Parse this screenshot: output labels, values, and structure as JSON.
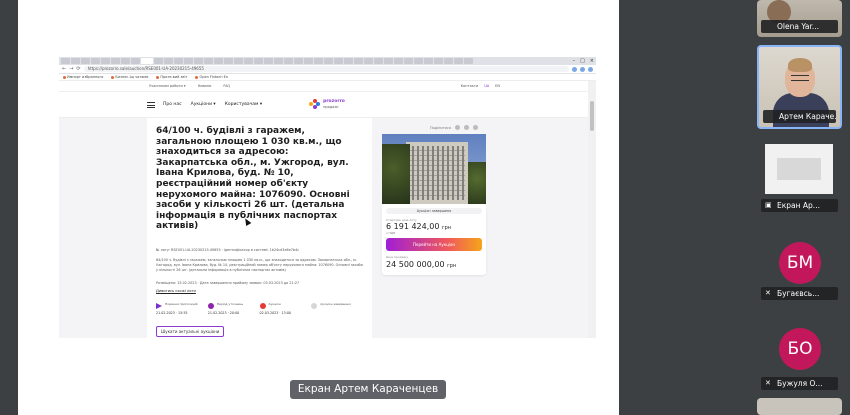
{
  "browser": {
    "url": "https://prozorro.sale/auction/RSE001-UA-20230215-49655",
    "window_controls": [
      "–",
      "□",
      "×"
    ],
    "nav": [
      "←",
      "→",
      "⟳"
    ],
    "bookmarks": [
      "Импорт избранного",
      "Бизнес-Іщ чатами",
      "Проте-вий звіт",
      "Open Fintech Ex"
    ]
  },
  "site": {
    "topbar_items": [
      "Учасникам роботи ▾",
      "Новини",
      "FAQ"
    ],
    "topbar_right": [
      "Контакти",
      "UA",
      "EN"
    ],
    "nav_items": [
      "Про нас",
      "Аукціони ▾",
      "Користувачам ▾"
    ],
    "logo_top": "prozorro",
    "logo_bottom": "продажі",
    "lot": {
      "title": "64/100 ч. будівлі з гаражем, загальною площею 1 030 кв.м., що знаходиться за адресою: Закарпатська обл., м. Ужгород, вул. Івана Крилова, буд. № 10, реєстраційний номер об'єкту нерухомого майна: 1076090. Основні засоби у кількості 26 шт. (детальна інформація в публічних паспортах активів)",
      "meta": "№ лоту: RSE001-UA-20230215-49655 · ідентифікатор в системі: 1b24cd3e6e7b4c",
      "description": "64/100 ч. будівлі з гаражем, загальною площею 1 030 кв.м., що знаходиться за адресою: Закарпатська обл., м. Ужгород, вул. Івана Крилова, буд. № 10, реєстраційний номер об'єкту нерухомого майна: 1076090. Основні засоби у кількості 26 шт. (детальна інформація в публічних паспортах активів)",
      "dates": "Розміщено: 15.02.2023 · Дата завершення прийому заявок: 03.03.2023 до 21:27",
      "link": "Дивитись схожі лоти",
      "timeline": [
        {
          "label": "Подання пропозицій",
          "date": "21.02.2023 · 15:55",
          "color": "#7a2fd0",
          "shape": "tri"
        },
        {
          "label": "Період уточнень",
          "date": "21.02.2023 · 20:00",
          "color": "#8e24aa",
          "shape": "dot"
        },
        {
          "label": "Аукціон",
          "date": "02.03.2023 · 13:00",
          "color": "#e53935",
          "shape": "dot"
        },
        {
          "label": "Аукціон завершено",
          "date": "",
          "color": "#d6d6d6",
          "shape": "dot"
        }
      ],
      "search_button": "Шукати актуальні аукціони"
    },
    "card": {
      "share_label": "Поділитися",
      "badge": "Аукціон завершено",
      "start_price_label": "Стартова ціна лоту",
      "start_price": "6 191 424,00",
      "currency": "грн",
      "vat_label": "з ПДВ",
      "action_button": "Перейти на Аукціон",
      "final_price_label": "Ціна продажу",
      "final_price": "24 500 000,00"
    }
  },
  "caption": "Екран Артем Караченцев",
  "participants": [
    {
      "name": "Olena Yar...",
      "type": "video"
    },
    {
      "name": "Артем Караче...",
      "type": "video",
      "active": true
    },
    {
      "name": "Екран Ар...",
      "type": "screen"
    },
    {
      "name": "Бугаєвсь...",
      "type": "avatar",
      "initials": "БМ",
      "muted": true
    },
    {
      "name": "Бужуля О...",
      "type": "avatar",
      "initials": "БО",
      "muted": true
    }
  ],
  "colors": {
    "avatar": "#c2185b",
    "brand": "#8a3bd2",
    "active_border": "#8ab4f8"
  }
}
